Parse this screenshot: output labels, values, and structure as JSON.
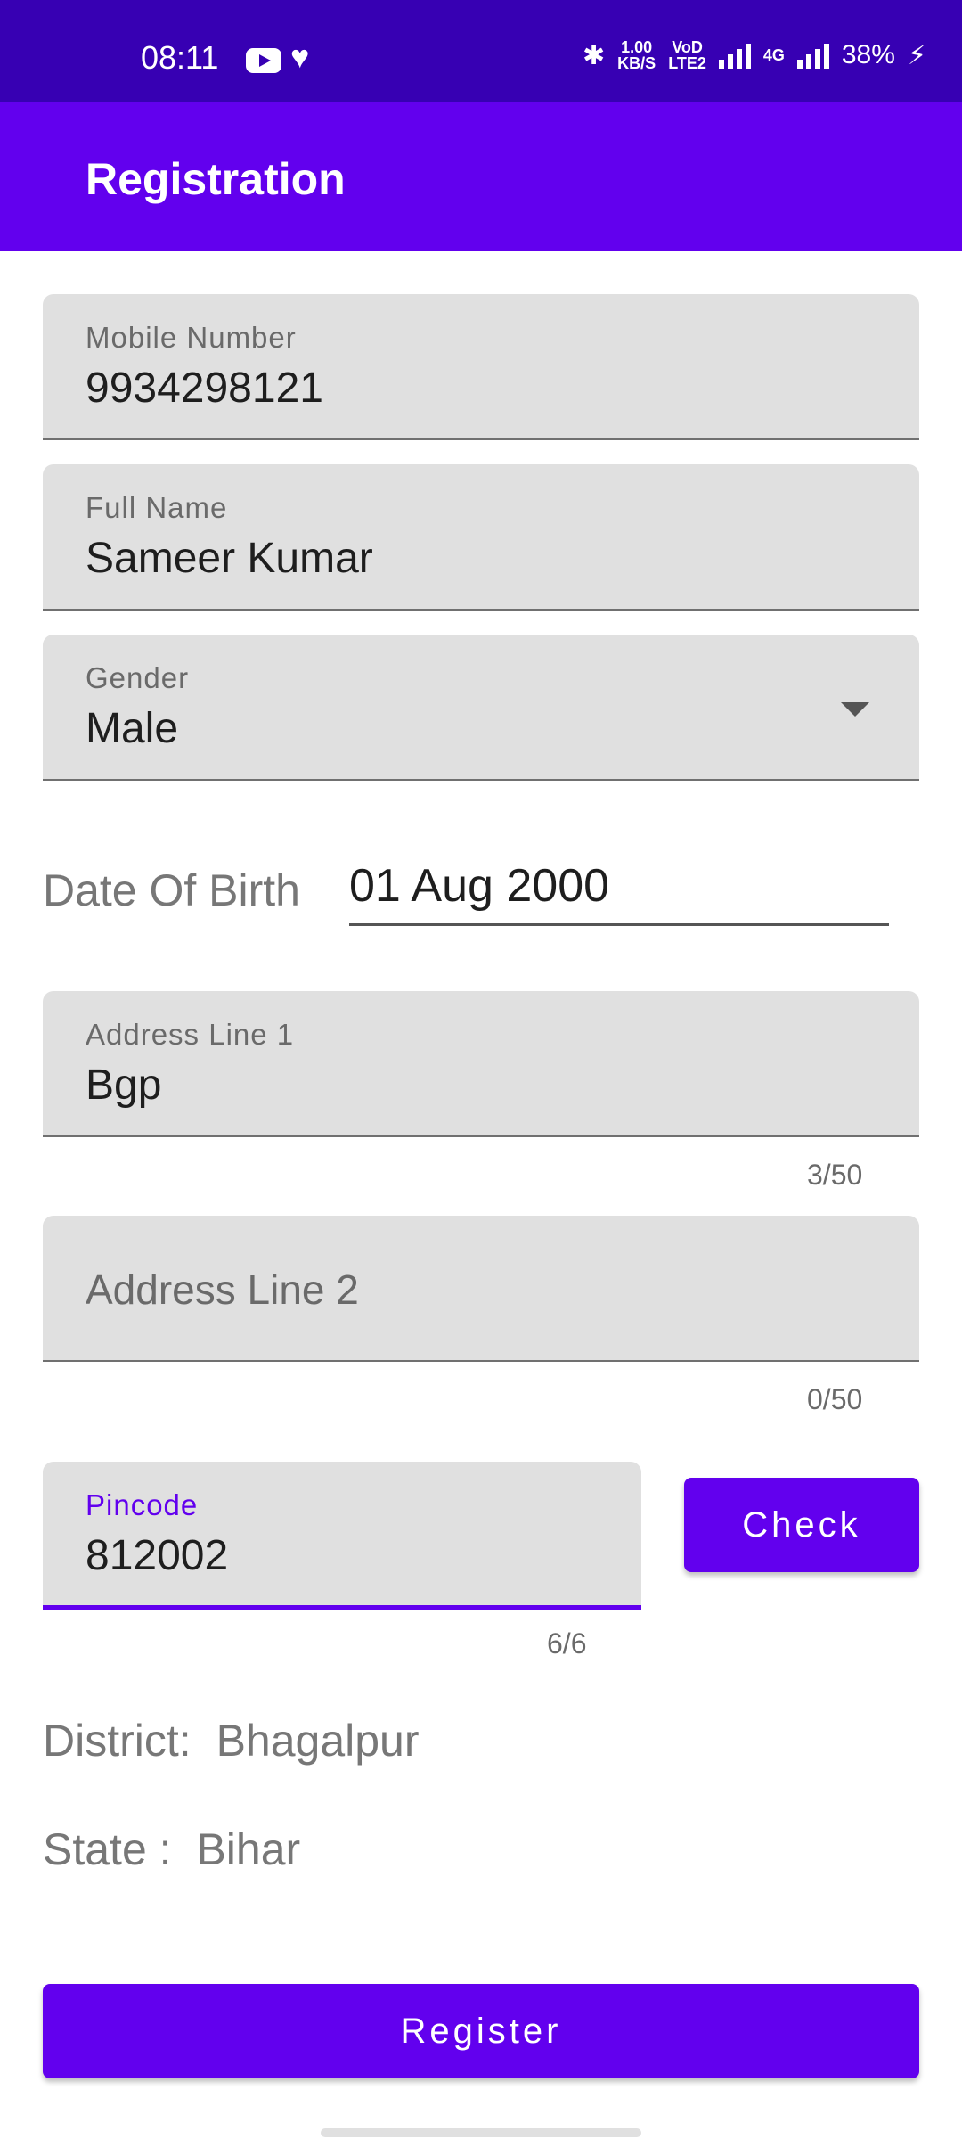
{
  "status_bar": {
    "time": "08:11",
    "net_speed_top": "1.00",
    "net_speed_bottom": "KB/S",
    "volte_top": "VoD",
    "volte_bottom": "LTE2",
    "network_label": "4G",
    "battery": "38%"
  },
  "app_bar": {
    "title": "Registration"
  },
  "form": {
    "mobile": {
      "label": "Mobile Number",
      "value": "9934298121"
    },
    "full_name": {
      "label": "Full Name",
      "value": "Sameer Kumar"
    },
    "gender": {
      "label": "Gender",
      "value": "Male"
    },
    "dob": {
      "label": "Date Of Birth",
      "value": "01 Aug 2000"
    },
    "address1": {
      "label": "Address Line 1",
      "value": "Bgp",
      "counter": "3/50"
    },
    "address2": {
      "placeholder": "Address Line 2",
      "counter": "0/50"
    },
    "pincode": {
      "label": "Pincode",
      "value": "812002",
      "counter": "6/6"
    },
    "check_button": "Check",
    "district_label": "District:",
    "district_value": "Bhagalpur",
    "state_label": "State :",
    "state_value": "Bihar",
    "register_button": "Register"
  },
  "colors": {
    "primary": "#6200ee",
    "primary_dark": "#3700b3",
    "field_bg": "#e0e0e0"
  }
}
